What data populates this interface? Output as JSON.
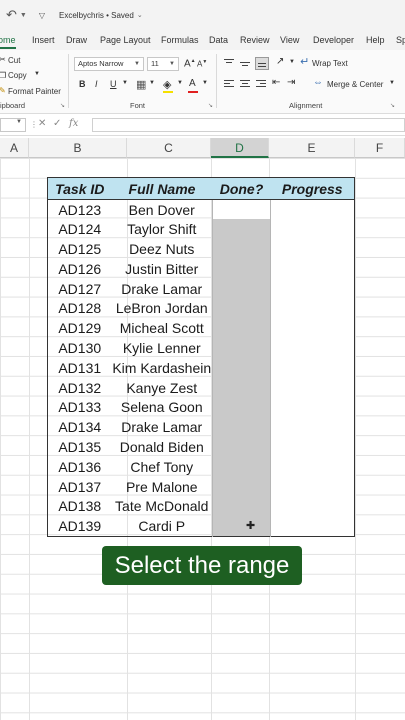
{
  "titlebar": {
    "undo_icon": "undo-icon",
    "title": "Excelbychris • Saved"
  },
  "tabs": [
    "ome",
    "Insert",
    "Draw",
    "Page Layout",
    "Formulas",
    "Data",
    "Review",
    "View",
    "Developer",
    "Help",
    "Sp"
  ],
  "active_tab": "ome",
  "ribbon": {
    "clipboard": {
      "cut": "Cut",
      "copy": "Copy",
      "format_painter": "Format Painter",
      "label": "ipboard"
    },
    "font": {
      "font_name": "Aptos Narrow",
      "font_size": "11",
      "bold": "B",
      "italic": "I",
      "underline": "U",
      "label": "Font",
      "font_color_hex": "#e02020",
      "fill_color_hex": "#f5e000"
    },
    "alignment": {
      "wrap_text": "Wrap Text",
      "merge_center": "Merge & Center",
      "label": "Alignment"
    }
  },
  "formula_bar": {
    "fx": "fx",
    "cancel": "✕",
    "enter": "✓"
  },
  "columns": [
    "A",
    "B",
    "C",
    "D",
    "E",
    "F"
  ],
  "selected_column": "D",
  "table": {
    "headers": [
      "Task ID",
      "Full Name",
      "Done?",
      "Progress"
    ],
    "rows": [
      {
        "id": "AD123",
        "name": "Ben Dover"
      },
      {
        "id": "AD124",
        "name": "Taylor Shift"
      },
      {
        "id": "AD125",
        "name": "Deez Nuts"
      },
      {
        "id": "AD126",
        "name": "Justin Bitter"
      },
      {
        "id": "AD127",
        "name": "Drake Lamar"
      },
      {
        "id": "AD128",
        "name": "LeBron Jordan"
      },
      {
        "id": "AD129",
        "name": "Micheal Scott"
      },
      {
        "id": "AD130",
        "name": "Kylie Lenner"
      },
      {
        "id": "AD131",
        "name": "Kim Kardashein"
      },
      {
        "id": "AD132",
        "name": "Kanye Zest"
      },
      {
        "id": "AD133",
        "name": "Selena Goon"
      },
      {
        "id": "AD134",
        "name": "Drake Lamar"
      },
      {
        "id": "AD135",
        "name": "Donald Biden"
      },
      {
        "id": "AD136",
        "name": "Chef Tony"
      },
      {
        "id": "AD137",
        "name": "Pre Malone"
      },
      {
        "id": "AD138",
        "name": "Tate McDonald"
      },
      {
        "id": "AD139",
        "name": "Cardi P"
      }
    ],
    "header_fill_hex": "#bfe3f0",
    "selection_fill_hex": "#c9c9c9"
  },
  "caption": "Select the range",
  "caption_bg_hex": "#1e5f22"
}
